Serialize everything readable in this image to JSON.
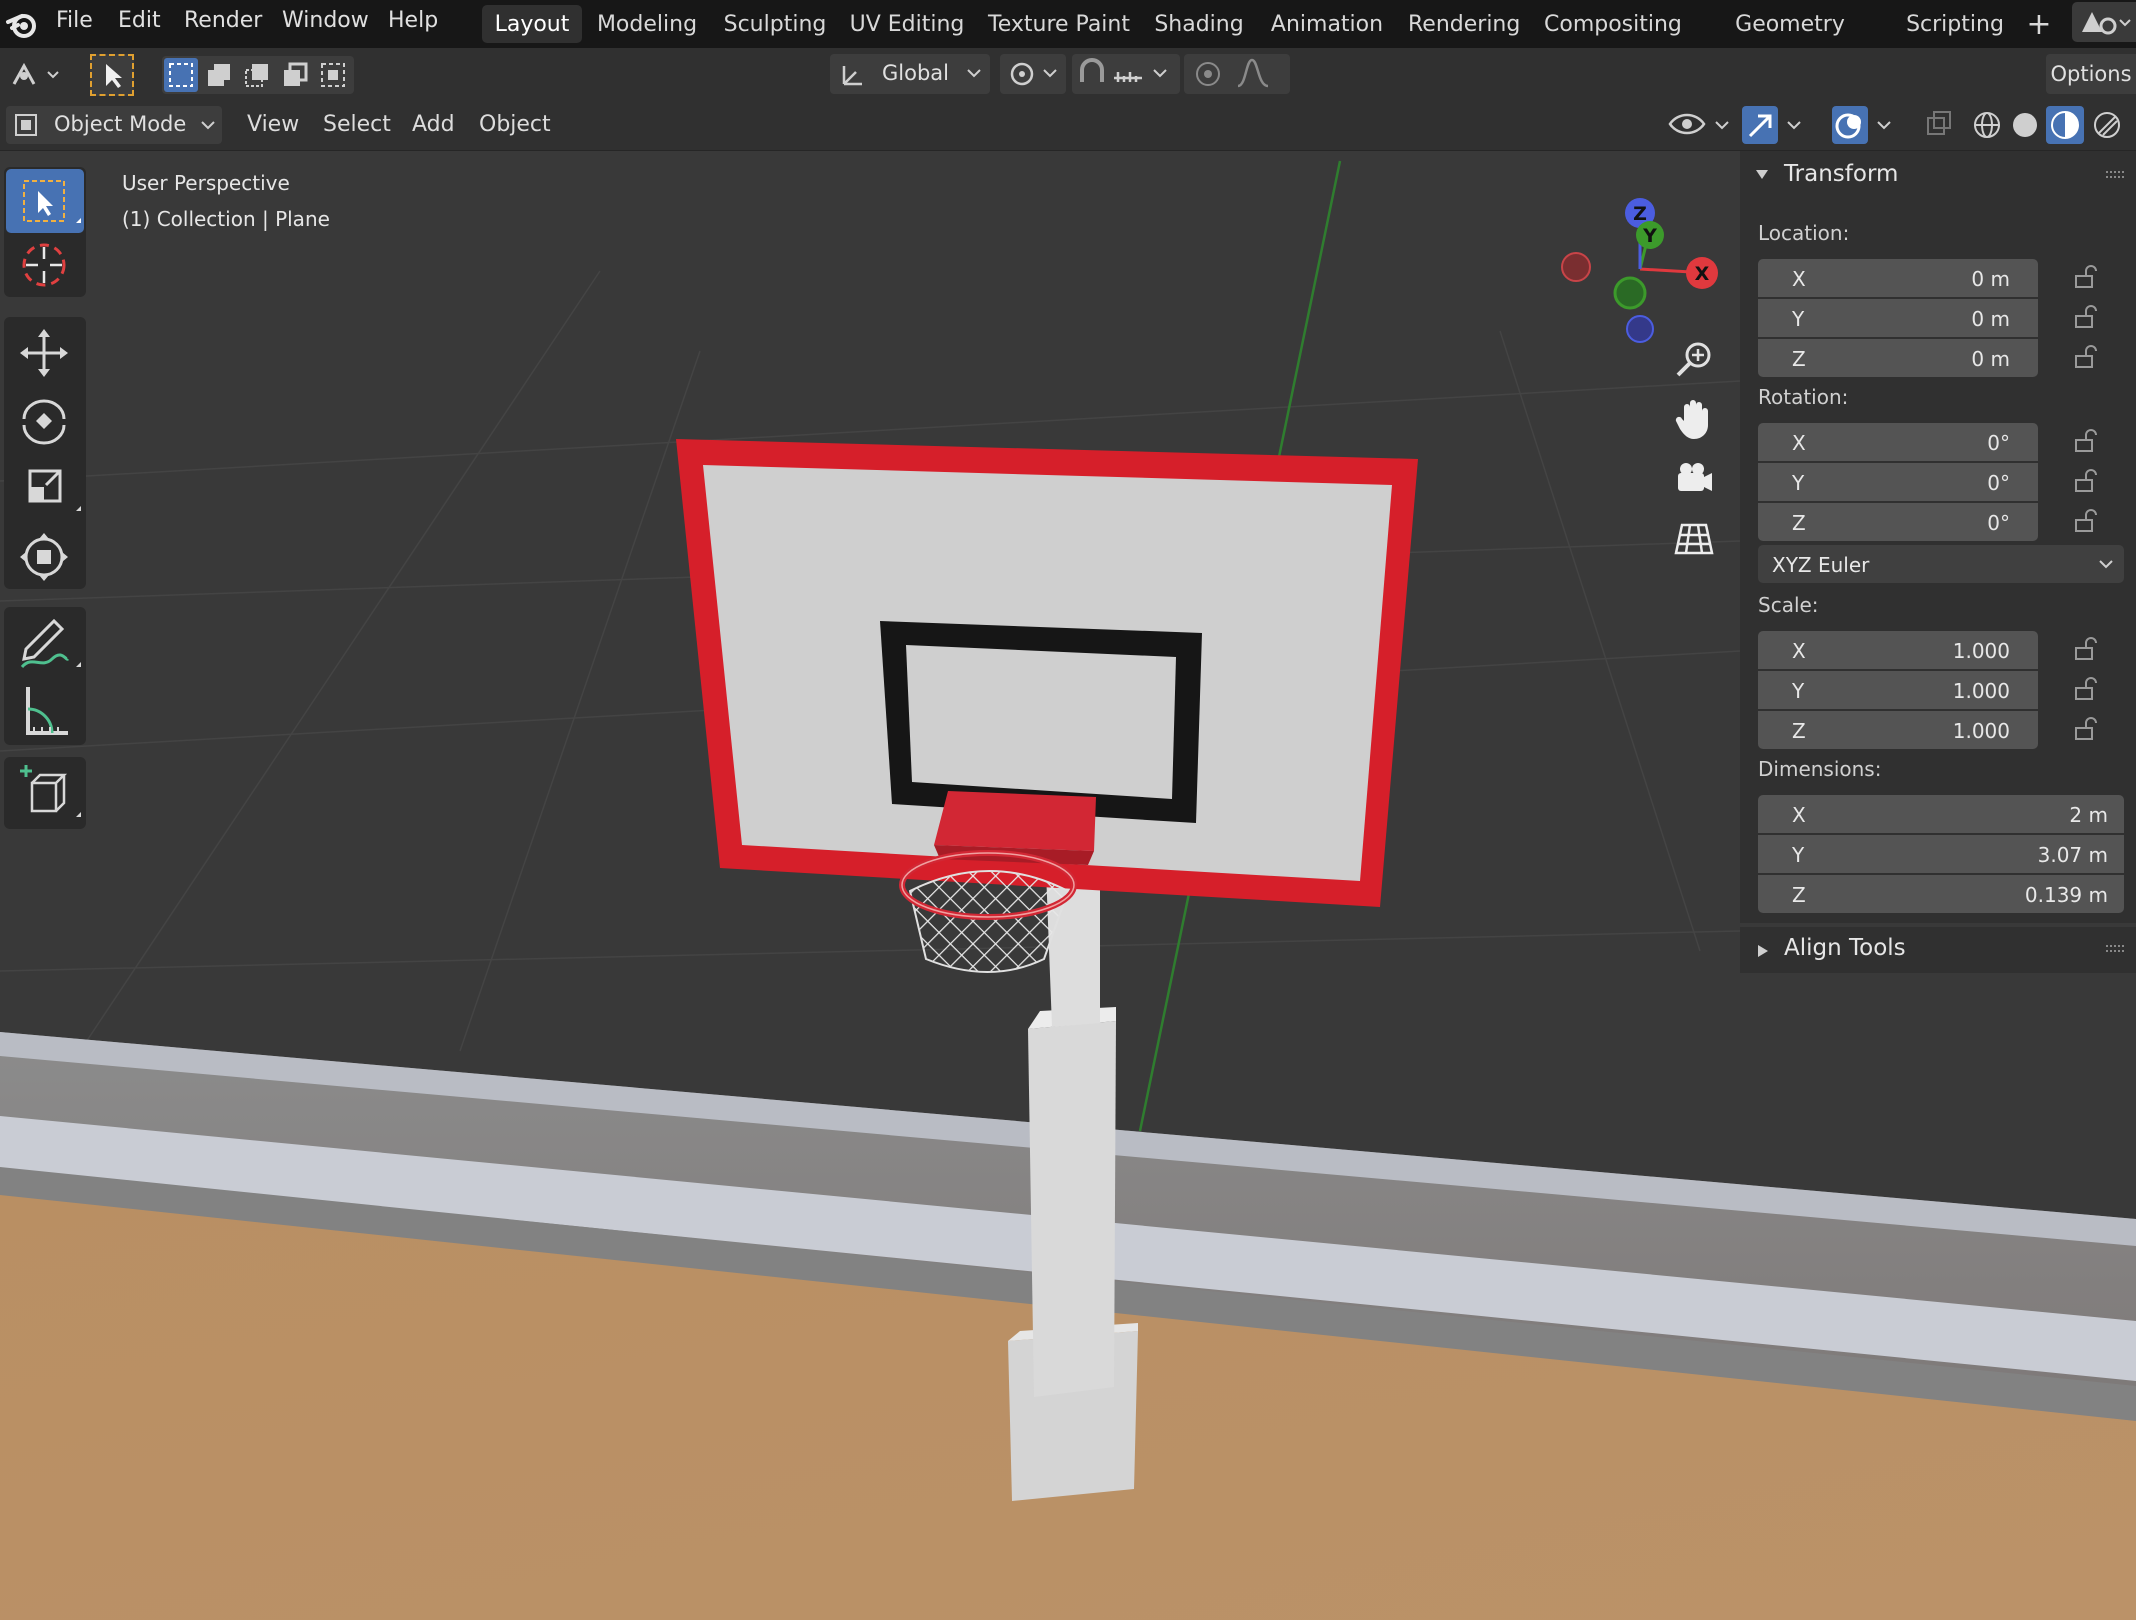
{
  "menu": {
    "items": [
      "File",
      "Edit",
      "Render",
      "Window",
      "Help"
    ]
  },
  "workspaces": {
    "tabs": [
      "Layout",
      "Modeling",
      "Sculpting",
      "UV Editing",
      "Texture Paint",
      "Shading",
      "Animation",
      "Rendering",
      "Compositing",
      "Geometry Nodes",
      "Scripting"
    ],
    "active": "Layout"
  },
  "toolheader": {
    "orientation": "Global",
    "options_label": "Options"
  },
  "header": {
    "mode": "Object Mode",
    "menus": [
      "View",
      "Select",
      "Add",
      "Object"
    ]
  },
  "viewport": {
    "line1": "User Perspective",
    "line2": "(1) Collection | Plane",
    "gizmo": {
      "x": "X",
      "y": "Y",
      "z": "Z"
    }
  },
  "npanel": {
    "transform_title": "Transform",
    "align_title": "Align Tools",
    "location_label": "Location:",
    "rotation_label": "Rotation:",
    "scale_label": "Scale:",
    "dimensions_label": "Dimensions:",
    "rotation_mode": "XYZ Euler",
    "location": [
      {
        "axis": "X",
        "value": "0 m"
      },
      {
        "axis": "Y",
        "value": "0 m"
      },
      {
        "axis": "Z",
        "value": "0 m"
      }
    ],
    "rotation": [
      {
        "axis": "X",
        "value": "0°"
      },
      {
        "axis": "Y",
        "value": "0°"
      },
      {
        "axis": "Z",
        "value": "0°"
      }
    ],
    "scale": [
      {
        "axis": "X",
        "value": "1.000"
      },
      {
        "axis": "Y",
        "value": "1.000"
      },
      {
        "axis": "Z",
        "value": "1.000"
      }
    ],
    "dimensions": [
      {
        "axis": "X",
        "value": "2 m"
      },
      {
        "axis": "Y",
        "value": "3.07 m"
      },
      {
        "axis": "Z",
        "value": "0.139 m"
      }
    ]
  },
  "colors": {
    "accent": "#4772b3",
    "axis_x": "#e0393e",
    "axis_y": "#3c9a2b",
    "axis_z": "#4b5de0",
    "backboard_red": "#d61f2a",
    "floor": "#b9906a"
  }
}
